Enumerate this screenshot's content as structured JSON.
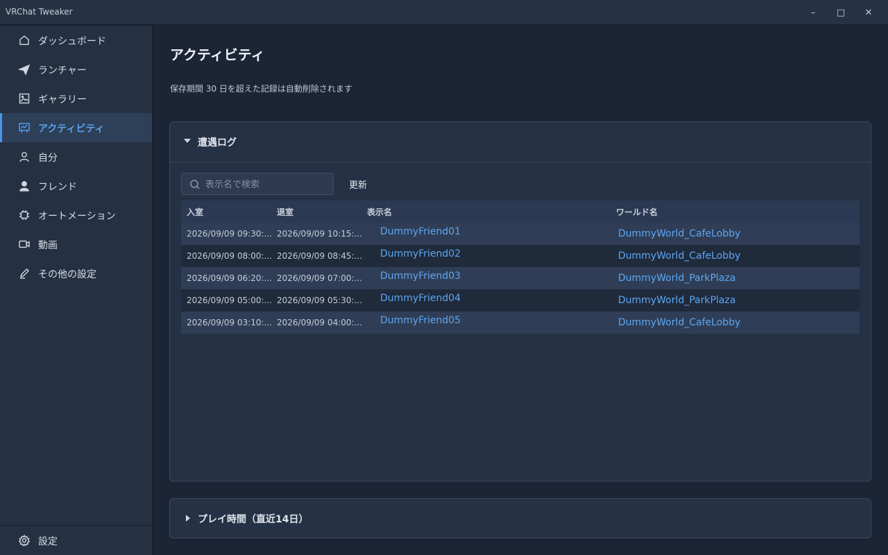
{
  "window": {
    "title": "VRChat Tweaker",
    "minimize": "–",
    "maximize": "□",
    "close": "✕"
  },
  "sidebar": {
    "items": [
      {
        "label": "ダッシュボード",
        "icon": "home-icon"
      },
      {
        "label": "ランチャー",
        "icon": "send-icon"
      },
      {
        "label": "ギャラリー",
        "icon": "image-icon"
      },
      {
        "label": "アクティビティ",
        "icon": "presentation-icon",
        "active": true
      },
      {
        "label": "自分",
        "icon": "user-outline-icon"
      },
      {
        "label": "フレンド",
        "icon": "user-solid-icon"
      },
      {
        "label": "オートメーション",
        "icon": "chip-icon"
      },
      {
        "label": "動画",
        "icon": "video-icon"
      },
      {
        "label": "その他の設定",
        "icon": "pen-icon"
      }
    ],
    "settings": {
      "label": "設定",
      "icon": "gear-icon"
    }
  },
  "main": {
    "title": "アクティビティ",
    "subtitle": "保存期間 30 日を超えた記録は自動削除されます",
    "encounter_panel": {
      "title": "遭遇ログ",
      "search_placeholder": "表示名で検索",
      "refresh_label": "更新",
      "columns": [
        "入室",
        "退室",
        "表示名",
        "ワールド名"
      ],
      "rows": [
        [
          "2026/09/09 09:30:...",
          "2026/09/09 10:15:...",
          "DummyFriend01",
          "DummyWorld_CafeLobby"
        ],
        [
          "2026/09/09 08:00:...",
          "2026/09/09 08:45:...",
          "DummyFriend02",
          "DummyWorld_CafeLobby"
        ],
        [
          "2026/09/09 06:20:...",
          "2026/09/09 07:00:...",
          "DummyFriend03",
          "DummyWorld_ParkPlaza"
        ],
        [
          "2026/09/09 05:00:...",
          "2026/09/09 05:30:...",
          "DummyFriend04",
          "DummyWorld_ParkPlaza"
        ],
        [
          "2026/09/09 03:10:...",
          "2026/09/09 04:00:...",
          "DummyFriend05",
          "DummyWorld_CafeLobby"
        ]
      ]
    },
    "playtime_panel": {
      "title": "プレイ時間（直近14日）"
    }
  },
  "colors": {
    "accent": "#4d94e8",
    "link": "#5ea6f2",
    "background": "#1c2536",
    "sidebar": "#253143"
  }
}
